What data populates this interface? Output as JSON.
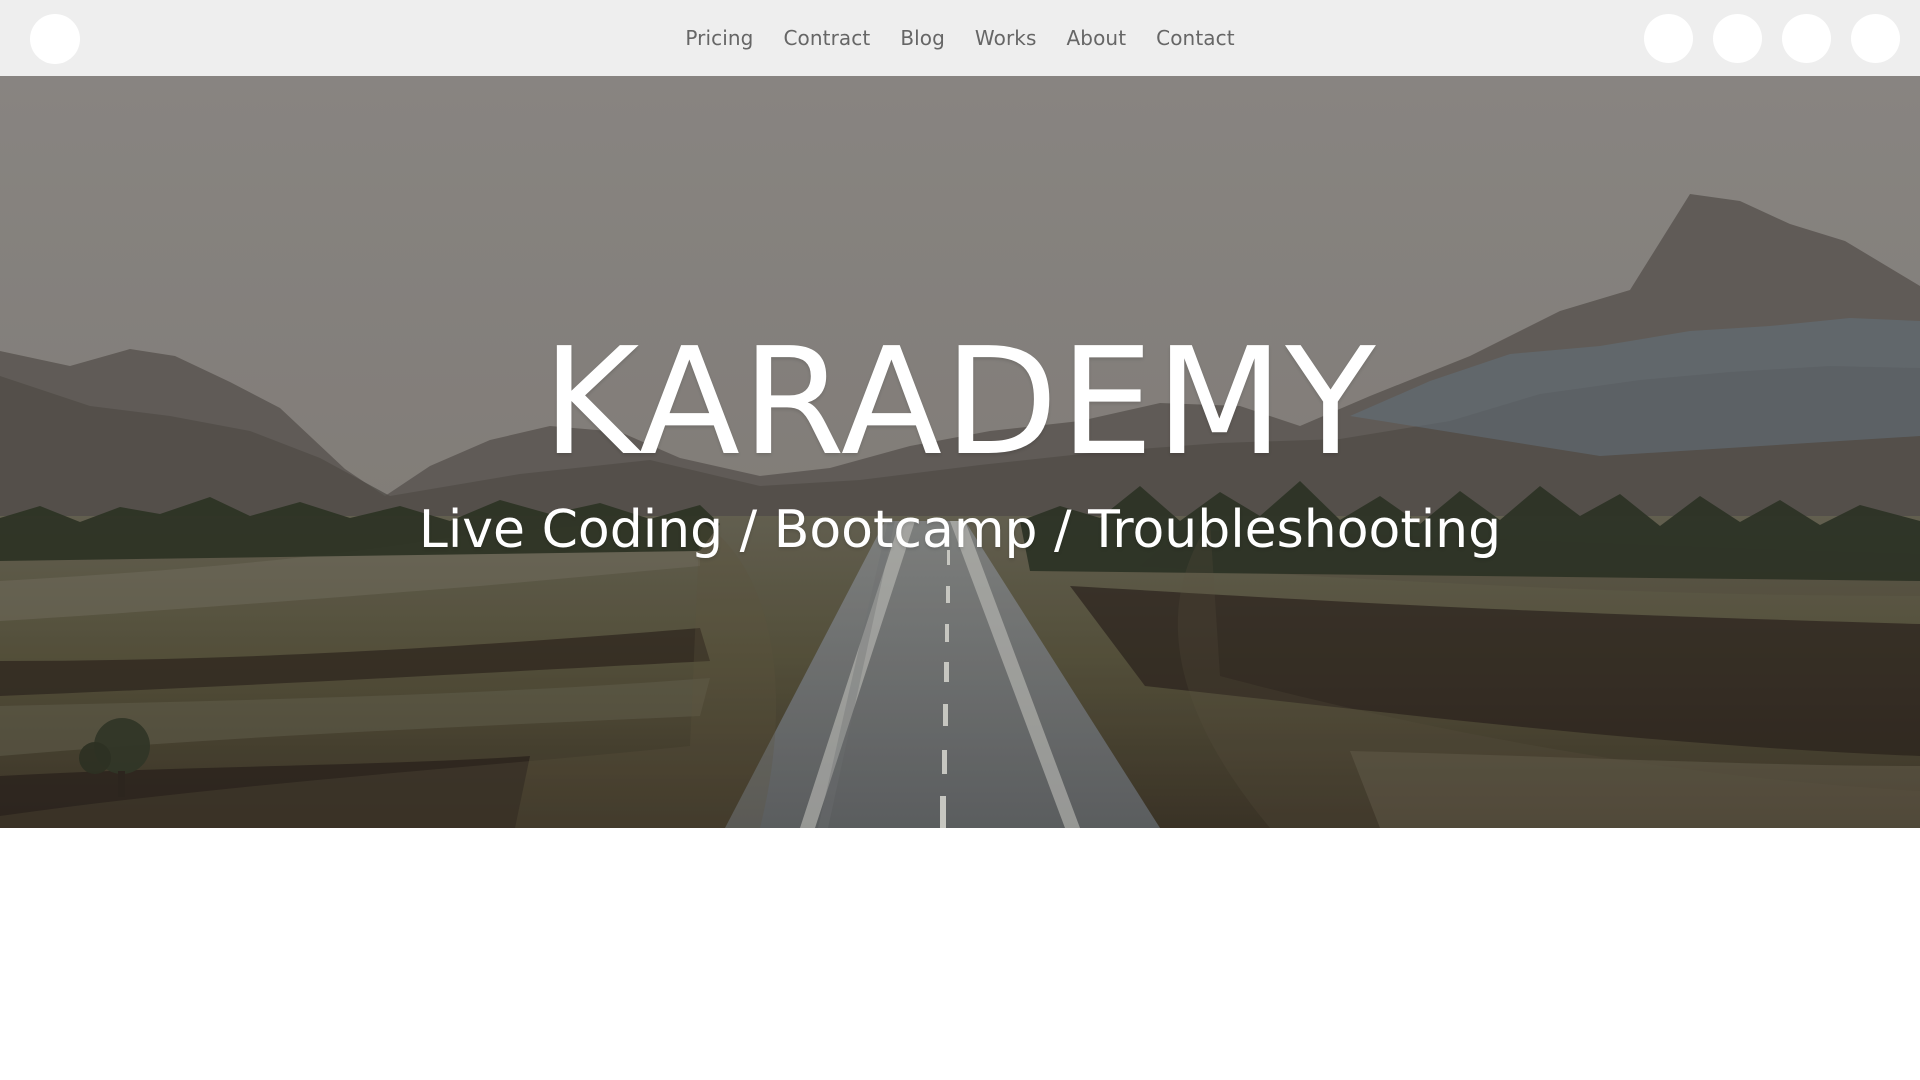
{
  "header": {
    "nav_items": [
      {
        "label": "Pricing"
      },
      {
        "label": "Contract"
      },
      {
        "label": "Blog"
      },
      {
        "label": "Works"
      },
      {
        "label": "About"
      },
      {
        "label": "Contact"
      }
    ],
    "social_icons": [
      {
        "icon": "social-icon-1"
      },
      {
        "icon": "social-icon-2"
      },
      {
        "icon": "social-icon-3"
      },
      {
        "icon": "social-icon-4"
      }
    ]
  },
  "hero": {
    "title": "KARADEMY",
    "subtitle": "Live Coding / Bootcamp / Troubleshooting"
  },
  "colors": {
    "header_background": "#eeeeee",
    "nav_text": "#666666",
    "hero_text": "#ffffff",
    "page_background": "#ffffff"
  }
}
